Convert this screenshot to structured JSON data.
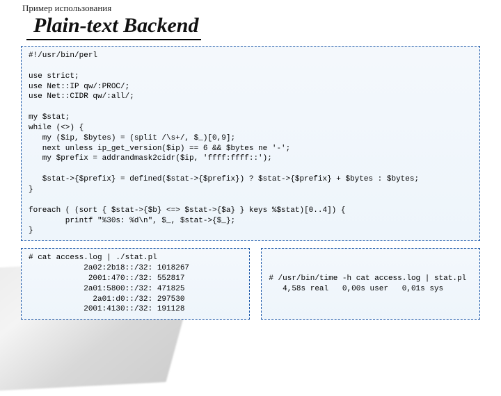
{
  "title": "Plain-text Backend",
  "subtitle": "Пример использования",
  "code_main": "#!/usr/bin/perl\n\nuse strict;\nuse Net::IP qw/:PROC/;\nuse Net::CIDR qw/:all/;\n\nmy $stat;\nwhile (<>) {\n   my ($ip, $bytes) = (split /\\s+/, $_)[0,9];\n   next unless ip_get_version($ip) == 6 && $bytes ne '-';\n   my $prefix = addrandmask2cidr($ip, 'ffff:ffff::');\n\n   $stat->{$prefix} = defined($stat->{$prefix}) ? $stat->{$prefix} + $bytes : $bytes;\n}\n\nforeach ( (sort { $stat->{$b} <=> $stat->{$a} } keys %$stat)[0..4]) {\n        printf \"%30s: %d\\n\", $_, $stat->{$_};\n}",
  "code_output": "# cat access.log | ./stat.pl\n            2a02:2b18::/32: 1018267\n             2001:470::/32: 552817\n            2a01:5800::/32: 471825\n              2a01:d0::/32: 297530\n            2001:4130::/32: 191128",
  "code_timing": "# /usr/bin/time -h cat access.log | stat.pl\n   4,58s real   0,00s user   0,01s sys"
}
